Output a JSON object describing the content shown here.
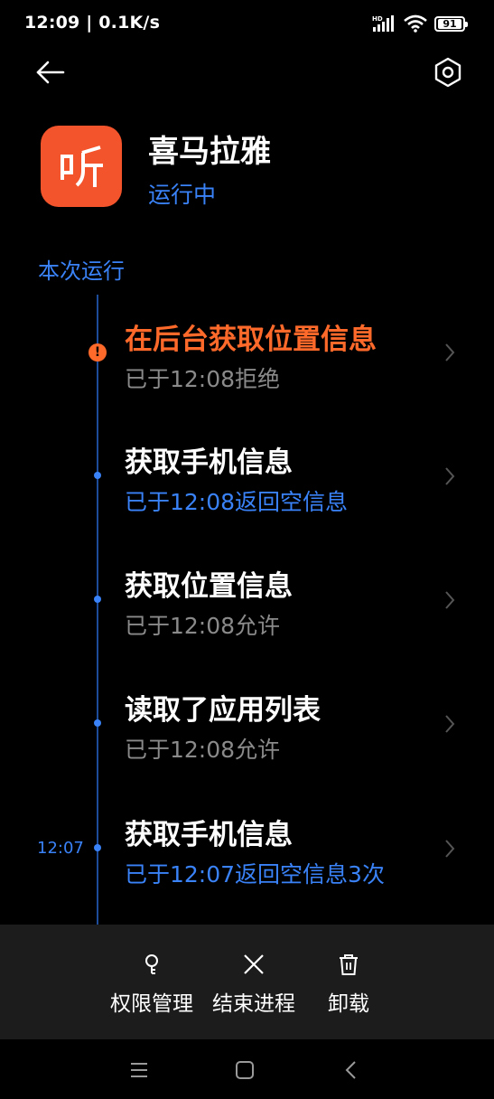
{
  "status_bar": {
    "time_speed": "12:09 | 0.1K/s",
    "battery": "91",
    "hd": "HD"
  },
  "app": {
    "name": "喜马拉雅",
    "state": "运行中",
    "icon_label": "听",
    "icon_color": "#f3542c"
  },
  "section_title": "本次运行",
  "timeline": [
    {
      "title": "在后台获取位置信息",
      "sub": "已于12:08拒绝",
      "time": "",
      "warn": true
    },
    {
      "title": "获取手机信息",
      "sub": "已于12:08返回空信息",
      "time": "",
      "warn": false
    },
    {
      "title": "获取位置信息",
      "sub": "已于12:08允许",
      "time": "",
      "warn": false
    },
    {
      "title": "读取了应用列表",
      "sub": "已于12:08允许",
      "time": "",
      "warn": false
    },
    {
      "title": "获取手机信息",
      "sub": "已于12:07返回空信息3次",
      "time": "12:07",
      "warn": false
    }
  ],
  "actions": {
    "permissions": "权限管理",
    "end_process": "结束进程",
    "uninstall": "卸载"
  },
  "colors": {
    "accent_blue": "#3a82f7",
    "warning_orange": "#ff6a2b"
  }
}
